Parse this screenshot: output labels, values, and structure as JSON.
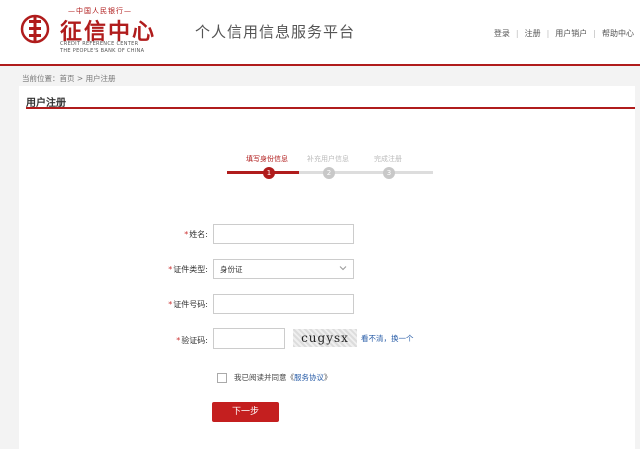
{
  "header": {
    "bank_name": "—中国人民银行—",
    "brand_title": "征信中心",
    "brand_en_line1": "CREDIT REFERENCE CENTER",
    "brand_en_line2": "THE PEOPLE'S BANK OF CHINA",
    "platform_title": "个人信用信息服务平台",
    "nav": [
      "登录",
      "注册",
      "用户销户",
      "帮助中心"
    ]
  },
  "breadcrumb": {
    "prefix": "当前位置：",
    "home": "首页",
    "separator": " > ",
    "current": "用户注册"
  },
  "panel": {
    "title": "用户注册"
  },
  "steps": [
    {
      "label": "填写身份信息",
      "number": "1",
      "active": true
    },
    {
      "label": "补充用户信息",
      "number": "2",
      "active": false
    },
    {
      "label": "完成注册",
      "number": "3",
      "active": false
    }
  ],
  "form": {
    "name_label": "姓名:",
    "id_type_label": "证件类型:",
    "id_type_value": "身份证",
    "id_number_label": "证件号码:",
    "captcha_label": "验证码:",
    "required_mark": "*",
    "captcha_text": "cugysx",
    "refresh_text": "看不清，换一个",
    "agree_prefix": "我已阅读并同意《",
    "agree_link": "服务协议",
    "agree_suffix": "》",
    "submit_label": "下一步"
  },
  "colors": {
    "brand_red": "#b01c1c",
    "button_red": "#c41f1f",
    "link_blue": "#2a5ea8",
    "inactive_gray": "#c8c8c8"
  }
}
